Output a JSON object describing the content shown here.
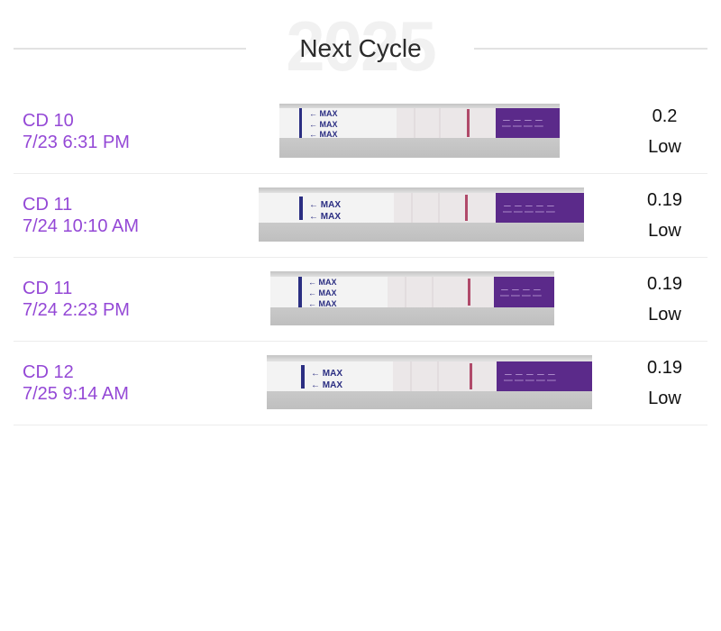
{
  "header": {
    "year": "2025",
    "title": "Next Cycle"
  },
  "rows": [
    {
      "cycle_day": "CD 10",
      "datetime": "7/23 6:31 PM",
      "value": "0.2",
      "level": "Low"
    },
    {
      "cycle_day": "CD 11",
      "datetime": "7/24 10:10 AM",
      "value": "0.19",
      "level": "Low"
    },
    {
      "cycle_day": "CD 11",
      "datetime": "7/24 2:23 PM",
      "value": "0.19",
      "level": "Low"
    },
    {
      "cycle_day": "CD 12",
      "datetime": "7/25 9:14 AM",
      "value": "0.19",
      "level": "Low"
    }
  ],
  "strip": {
    "max_label": "MAX",
    "handle_color": "#5b2a8a",
    "line_color": "#b04a6a"
  }
}
